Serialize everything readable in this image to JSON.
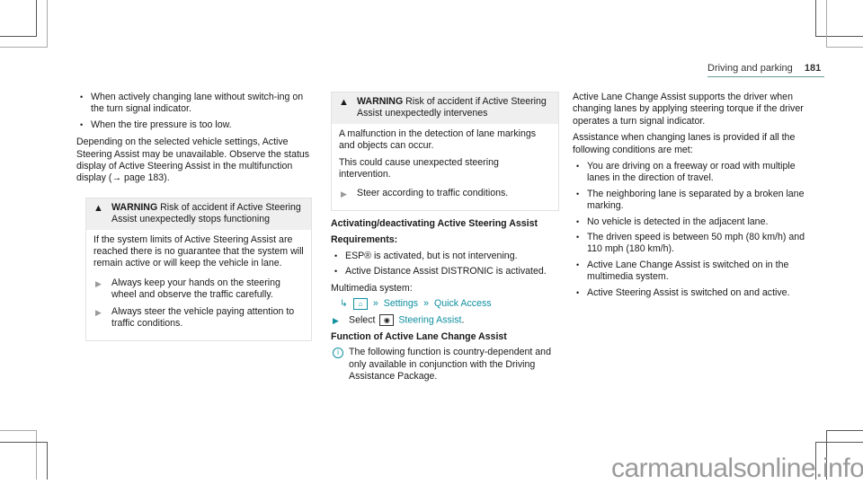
{
  "header": {
    "section": "Driving and parking",
    "page_number": "181"
  },
  "column1": {
    "bullets": [
      "When actively changing lane without switch-ing on the turn signal indicator.",
      "When the tire pressure is too low."
    ],
    "paragraph": "Depending on the selected vehicle settings, Active Steering Assist may be unavailable. Observe the status display of Active Steering Assist in the multifunction display (→ page 183).",
    "warning": {
      "label": "WARNING",
      "title": "Risk of accident if Active Steering Assist unexpectedly stops functioning",
      "body": "If the system limits of Active Steering Assist are reached there is no guarantee that the system will remain active or will keep the vehicle in lane.",
      "steps": [
        "Always keep your hands on the steering wheel and observe the traffic carefully.",
        "Always steer the vehicle paying attention to traffic conditions."
      ]
    }
  },
  "column2": {
    "warning": {
      "label": "WARNING",
      "title": "Risk of accident if Active Steering Assist unexpectedly intervenes",
      "body1": "A malfunction in the detection of lane markings and objects can occur.",
      "body2": "This could cause unexpected steering intervention.",
      "steps": [
        "Steer according to traffic conditions."
      ]
    },
    "heading1": "Activating/deactivating Active Steering Assist",
    "requirements_label": "Requirements:",
    "requirements": [
      "ESP® is activated, but is not intervening.",
      "Active Distance Assist DISTRONIC is activated."
    ],
    "multimedia_label": "Multimedia system:",
    "path": {
      "home_icon": "home-icon",
      "items": [
        "Settings",
        "Quick Access"
      ]
    },
    "select_step": {
      "prefix": "Select",
      "icon": "steering-wheel-icon",
      "link": "Steering Assist",
      "suffix": "."
    },
    "heading2": "Function of Active Lane Change Assist",
    "info_note": "The following function is country-dependent and only available in conjunction with the Driving Assistance Package."
  },
  "column3": {
    "para1": "Active Lane Change Assist supports the driver when changing lanes by applying steering torque if the driver operates a turn signal indicator.",
    "para2": "Assistance when changing lanes is provided if all the following conditions are met:",
    "conditions": [
      "You are driving on a freeway or road with multiple lanes in the direction of travel.",
      "The neighboring lane is separated by a broken lane marking.",
      "No vehicle is detected in the adjacent lane.",
      "The driven speed is between 50 mph (80 km/h) and 110 mph (180 km/h).",
      "Active Lane Change Assist is switched on in the multimedia system.",
      "Active Steering Assist is switched on and active."
    ]
  },
  "watermark": "carmanualsonline.info"
}
